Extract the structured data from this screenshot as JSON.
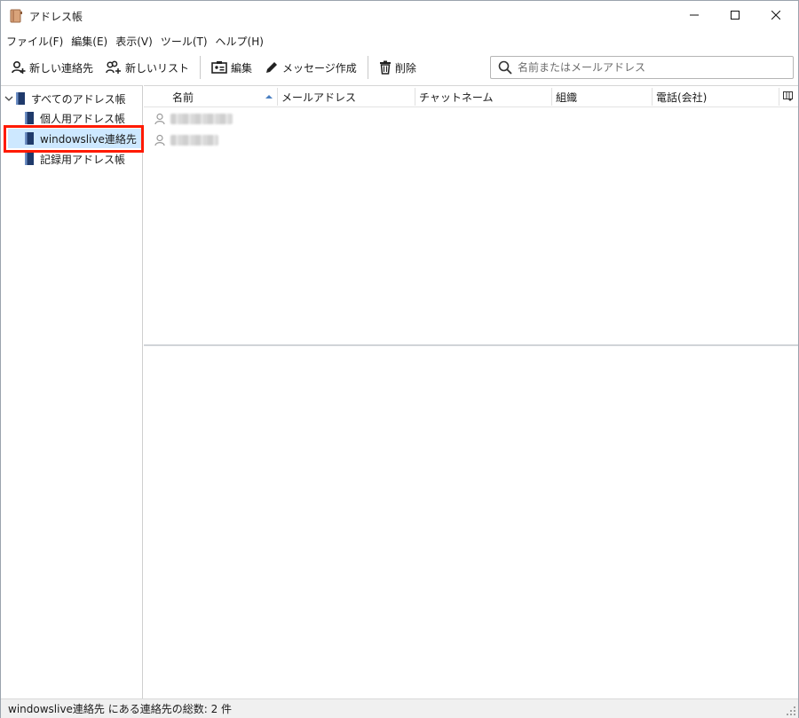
{
  "window": {
    "title": "アドレス帳",
    "minimize_symbol": "—",
    "maximize_symbol": "☐",
    "close_symbol": "✕"
  },
  "menu": [
    "ファイル(F)",
    "編集(E)",
    "表示(V)",
    "ツール(T)",
    "ヘルプ(H)"
  ],
  "toolbar": {
    "new_contact": "新しい連絡先",
    "new_list": "新しいリスト",
    "edit": "編集",
    "compose": "メッセージ作成",
    "delete": "削除"
  },
  "search": {
    "placeholder": "名前またはメールアドレス",
    "value": ""
  },
  "sidebar": {
    "root": "すべてのアドレス帳",
    "items": [
      {
        "label": "個人用アドレス帳",
        "selected": false
      },
      {
        "label": "windowslive連絡先",
        "selected": true
      },
      {
        "label": "記録用アドレス帳",
        "selected": false
      }
    ]
  },
  "list": {
    "columns": [
      "名前",
      "メールアドレス",
      "チャットネーム",
      "組織",
      "電話(会社)"
    ],
    "sort_column": "名前",
    "sort_direction": "ascending",
    "rows_count_visible": 2
  },
  "status": {
    "text": "windowslive連絡先 にある連絡先の総数: 2 件"
  },
  "colors": {
    "selection": "#cde8ff",
    "highlight_border": "#ff1a00",
    "book_blue": "#1f3a6b"
  },
  "icons": [
    "addressbook-app-icon",
    "new-contact-icon",
    "new-list-icon",
    "edit-card-icon",
    "pencil-icon",
    "trash-icon",
    "search-icon",
    "book-icon",
    "contact-person-icon",
    "column-picker-icon",
    "chevron-down-icon",
    "sort-up-icon",
    "resize-grip-icon"
  ]
}
